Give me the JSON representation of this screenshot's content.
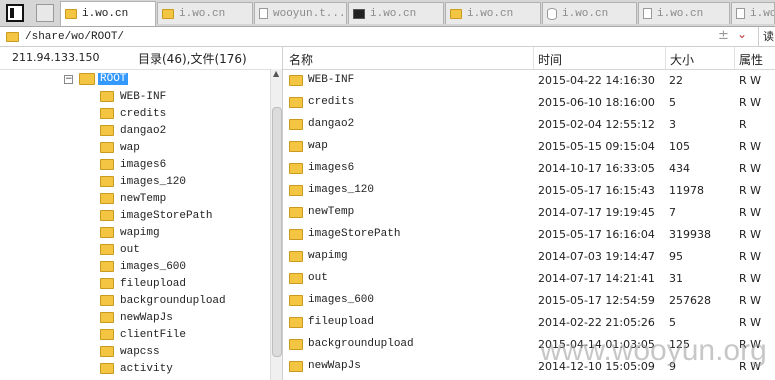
{
  "tabs": [
    {
      "label": "i.wo.cn",
      "icon": "folder-icon",
      "active": true
    },
    {
      "label": "i.wo.cn",
      "icon": "folder-icon",
      "active": false
    },
    {
      "label": "wooyun.t...",
      "icon": "file-icon",
      "active": false
    },
    {
      "label": "i.wo.cn",
      "icon": "terminal-icon",
      "active": false
    },
    {
      "label": "i.wo.cn",
      "icon": "folder-icon",
      "active": false
    },
    {
      "label": "i.wo.cn",
      "icon": "database-icon",
      "active": false
    },
    {
      "label": "i.wo.cn",
      "icon": "file-icon",
      "active": false
    },
    {
      "label": "i.wo",
      "icon": "file-icon",
      "active": false
    }
  ],
  "path": "/share/wo/ROOT/",
  "path_controls": {
    "add": "±",
    "dropdown": "⌄",
    "right": "读"
  },
  "left": {
    "ip": "211.94.133.150",
    "counts": "目录(46),文件(176)",
    "root": {
      "expander": "−",
      "label": "ROOT"
    },
    "items": [
      "WEB-INF",
      "credits",
      "dangao2",
      "wap",
      "images6",
      "images_120",
      "newTemp",
      "imageStorePath",
      "wapimg",
      "out",
      "images_600",
      "fileupload",
      "backgroundupload",
      "newWapJs",
      "clientFile",
      "wapcss",
      "activity"
    ]
  },
  "right": {
    "headers": {
      "name": "名称",
      "time": "时间",
      "size": "大小",
      "attr": "属性"
    },
    "rows": [
      {
        "name": "WEB-INF",
        "time": "2015-04-22 14:16:30",
        "size": "22",
        "attr": "R W"
      },
      {
        "name": "credits",
        "time": "2015-06-10 18:16:00",
        "size": "5",
        "attr": "R W"
      },
      {
        "name": "dangao2",
        "time": "2015-02-04 12:55:12",
        "size": "3",
        "attr": "R"
      },
      {
        "name": "wap",
        "time": "2015-05-15 09:15:04",
        "size": "105",
        "attr": "R W"
      },
      {
        "name": "images6",
        "time": "2014-10-17 16:33:05",
        "size": "434",
        "attr": "R W"
      },
      {
        "name": "images_120",
        "time": "2015-05-17 16:15:43",
        "size": "11978",
        "attr": "R W"
      },
      {
        "name": "newTemp",
        "time": "2014-07-17 19:19:45",
        "size": "7",
        "attr": "R W"
      },
      {
        "name": "imageStorePath",
        "time": "2015-05-17 16:16:04",
        "size": "319938",
        "attr": "R W"
      },
      {
        "name": "wapimg",
        "time": "2014-07-03 19:14:47",
        "size": "95",
        "attr": "R W"
      },
      {
        "name": "out",
        "time": "2014-07-17 14:21:41",
        "size": "31",
        "attr": "R W"
      },
      {
        "name": "images_600",
        "time": "2015-05-17 12:54:59",
        "size": "257628",
        "attr": "R W"
      },
      {
        "name": "fileupload",
        "time": "2014-02-22 21:05:26",
        "size": "5",
        "attr": "R W"
      },
      {
        "name": "backgroundupload",
        "time": "2015-04-14 01:03:05",
        "size": "125",
        "attr": "R W"
      },
      {
        "name": "newWapJs",
        "time": "2014-12-10 15:05:09",
        "size": "9",
        "attr": "R W"
      }
    ]
  },
  "watermark": "www.wooyun.org",
  "colors": {
    "selection": "#3399ff",
    "folder": "#f4c542",
    "tabbar": "#d6d6d6"
  }
}
